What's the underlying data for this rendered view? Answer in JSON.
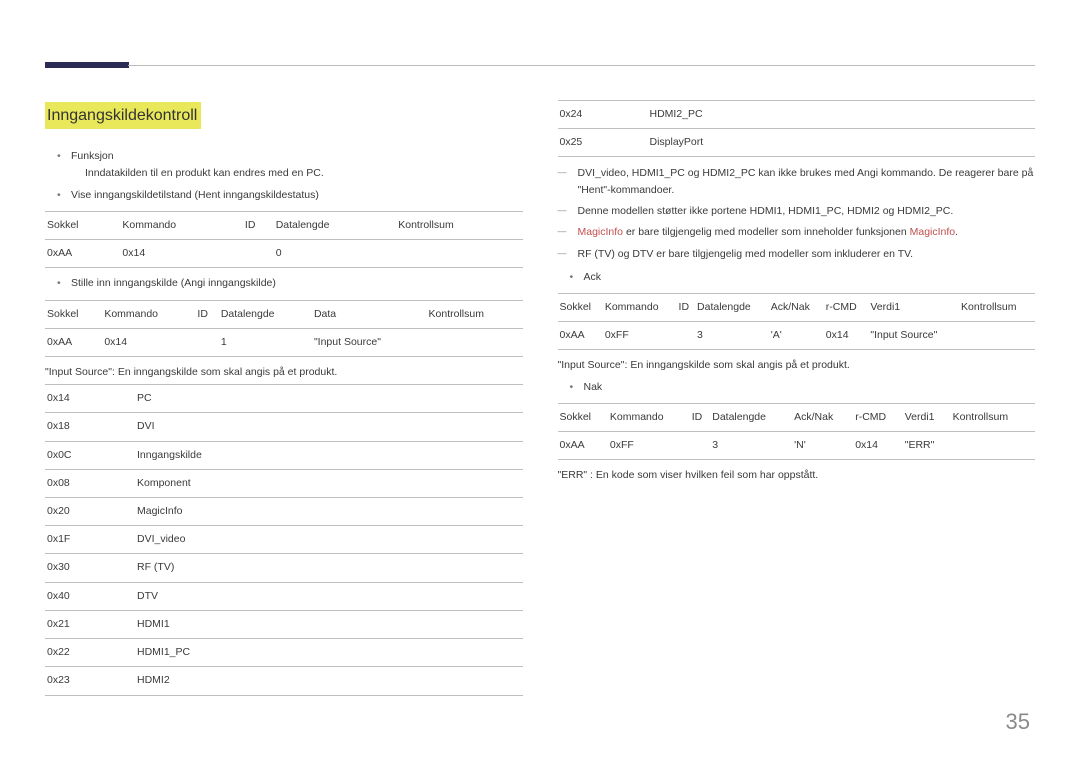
{
  "pageNumber": "35",
  "left": {
    "title": "Inngangskildekontroll",
    "bullet1": "Funksjon",
    "bullet1desc": "Inndatakilden til en produkt kan endres med en PC.",
    "bullet2": "Vise inngangskildetilstand (Hent inngangskildestatus)",
    "table1": {
      "headers": [
        "Sokkel",
        "Kommando",
        "ID",
        "Datalengde",
        "Kontrollsum"
      ],
      "row": [
        "0xAA",
        "0x14",
        "",
        "0",
        ""
      ]
    },
    "bullet3": "Stille inn inngangskilde (Angi inngangskilde)",
    "table2": {
      "headers": [
        "Sokkel",
        "Kommando",
        "ID",
        "Datalengde",
        "Data",
        "Kontrollsum"
      ],
      "row": [
        "0xAA",
        "0x14",
        "",
        "1",
        "\"Input Source\"",
        ""
      ]
    },
    "note1": "\"Input Source\": En inngangskilde som skal angis på et produkt.",
    "sources": [
      [
        "0x14",
        "PC"
      ],
      [
        "0x18",
        "DVI"
      ],
      [
        "0x0C",
        "Inngangskilde"
      ],
      [
        "0x08",
        "Komponent"
      ],
      [
        "0x20",
        "MagicInfo"
      ],
      [
        "0x1F",
        "DVI_video"
      ],
      [
        "0x30",
        "RF (TV)"
      ],
      [
        "0x40",
        "DTV"
      ],
      [
        "0x21",
        "HDMI1"
      ],
      [
        "0x22",
        "HDMI1_PC"
      ],
      [
        "0x23",
        "HDMI2"
      ]
    ]
  },
  "right": {
    "sourcesCont": [
      [
        "0x24",
        "HDMI2_PC"
      ],
      [
        "0x25",
        "DisplayPort"
      ]
    ],
    "dash1": "DVI_video, HDMI1_PC og HDMI2_PC kan ikke brukes med Angi kommando. De reagerer bare på \"Hent\"-kommandoer.",
    "dash2": "Denne modellen støtter ikke portene HDMI1, HDMI1_PC, HDMI2 og HDMI2_PC.",
    "dash3a": "MagicInfo",
    "dash3b": " er bare tilgjengelig med modeller som inneholder funksjonen ",
    "dash3c": "MagicInfo",
    "dash3d": ".",
    "dash4": "RF (TV) og DTV er bare tilgjengelig med modeller som inkluderer en TV.",
    "bulletAck": "Ack",
    "ackTable": {
      "headers": [
        "Sokkel",
        "Kommando",
        "ID",
        "Datalengde",
        "Ack/Nak",
        "r-CMD",
        "Verdi1",
        "Kontrollsum"
      ],
      "row": [
        "0xAA",
        "0xFF",
        "",
        "3",
        "'A'",
        "0x14",
        "\"Input Source\"",
        ""
      ]
    },
    "note2": "\"Input Source\": En inngangskilde som skal angis på et produkt.",
    "bulletNak": "Nak",
    "nakTable": {
      "headers": [
        "Sokkel",
        "Kommando",
        "ID",
        "Datalengde",
        "Ack/Nak",
        "r-CMD",
        "Verdi1",
        "Kontrollsum"
      ],
      "row": [
        "0xAA",
        "0xFF",
        "",
        "3",
        "'N'",
        "0x14",
        "\"ERR\"",
        ""
      ]
    },
    "note3": "\"ERR\" : En kode som viser hvilken feil som har oppstått."
  }
}
